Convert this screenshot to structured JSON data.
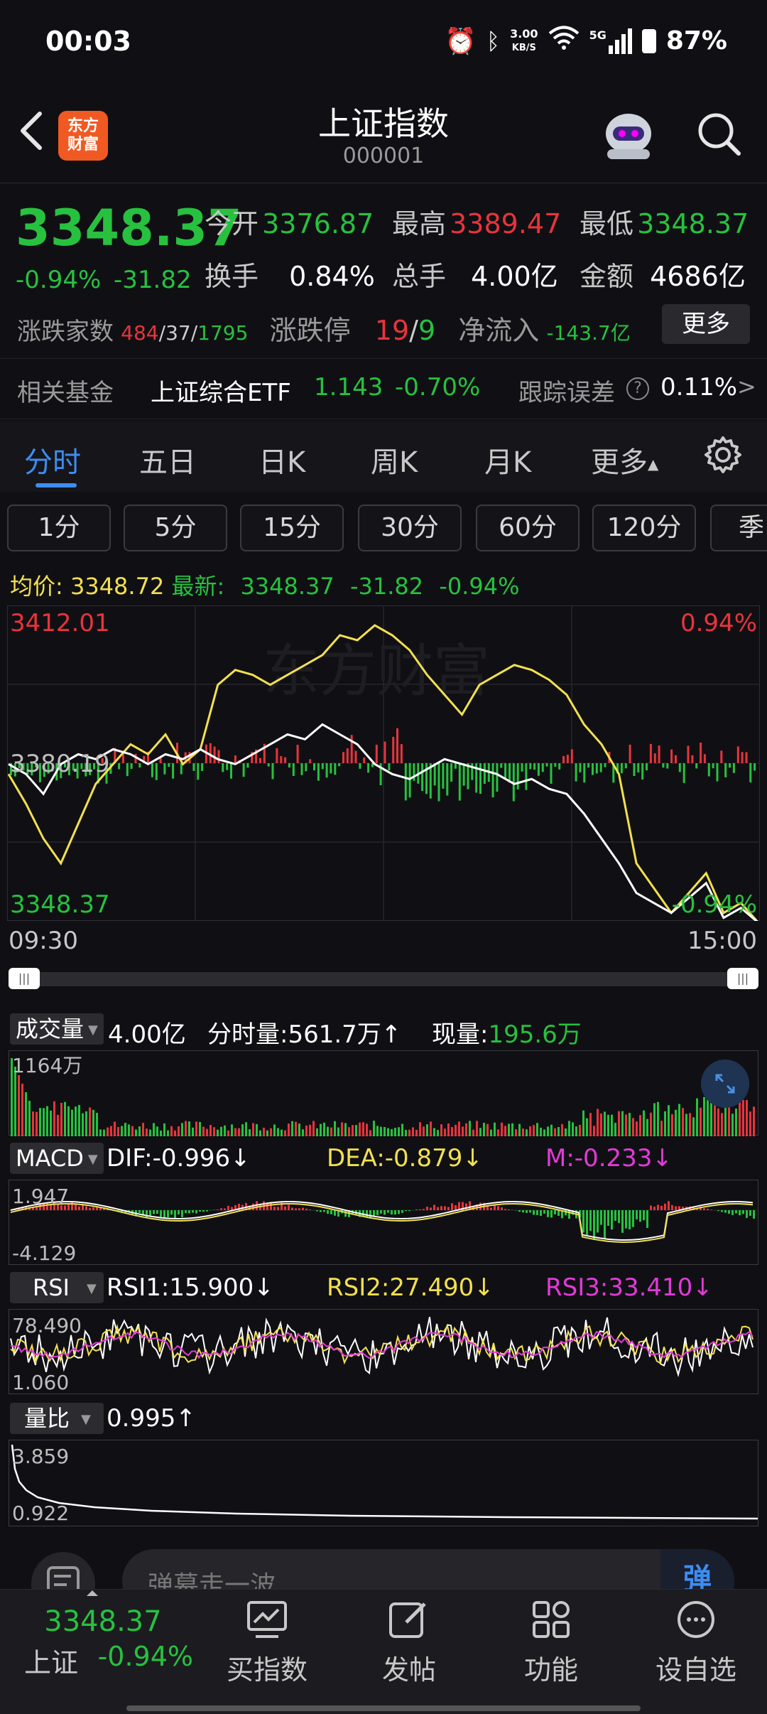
{
  "status": {
    "time": "00:03",
    "net_speed": "3.00",
    "net_unit": "KB/S",
    "signal": "5G",
    "battery": "87%"
  },
  "header": {
    "logo_line1": "东方",
    "logo_line2": "财富",
    "title": "上证指数",
    "code": "000001"
  },
  "quote": {
    "last": "3348.37",
    "chg_pct": "-0.94%",
    "chg_val": "-31.82",
    "open_label": "今开",
    "open": "3376.87",
    "high_label": "最高",
    "high": "3389.47",
    "low_label": "最低",
    "low": "3348.37",
    "turnover_label": "换手",
    "turnover": "0.84%",
    "volume_label": "总手",
    "volume": "4.00亿",
    "amount_label": "金额",
    "amount": "4686亿",
    "breadth_label": "涨跌家数",
    "breadth_up": "484",
    "breadth_flat": "37",
    "breadth_down": "1795",
    "limit_label": "涨跌停",
    "limit_up": "19",
    "limit_down": "9",
    "netflow_label": "净流入",
    "netflow": "-143.7亿",
    "more_label": "更多"
  },
  "fund": {
    "label": "相关基金",
    "name": "上证综合ETF",
    "price": "1.143",
    "chg": "-0.70%",
    "track_label": "跟踪误差",
    "track_value": "0.11%",
    "chevron": ">"
  },
  "tabs": [
    "分时",
    "五日",
    "日K",
    "周K",
    "月K",
    "更多"
  ],
  "periods": [
    "1分",
    "5分",
    "15分",
    "30分",
    "60分",
    "120分",
    "季"
  ],
  "avg_row": {
    "avg_label": "均价:",
    "avg": "3348.72",
    "latest_label": "最新:",
    "latest": "3348.37",
    "chg": "-31.82",
    "pct": "-0.94%"
  },
  "main_chart": {
    "top_left": "3412.01",
    "top_right": "0.94%",
    "mid_left": "3380.19",
    "bottom_left": "3348.37",
    "bottom_right": "-0.94%",
    "time_start": "09:30",
    "time_end": "15:00",
    "watermark": "东方财富"
  },
  "volume_panel": {
    "label": "成交量",
    "total": "4.00亿",
    "period_vol": "分时量:561.7万",
    "period_arrow": "↑",
    "now_label": "现量:",
    "now_value": "195.6万",
    "max_label": "1164万"
  },
  "macd_panel": {
    "label": "MACD",
    "dif": "DIF:-0.996",
    "dea": "DEA:-0.879",
    "m": "M:-0.233",
    "arrow": "↓",
    "top": "1.947",
    "bottom": "-4.129"
  },
  "rsi_panel": {
    "label": "RSI",
    "rsi1": "RSI1:15.900",
    "rsi2": "RSI2:27.490",
    "rsi3": "RSI3:33.410",
    "arrow": "↓",
    "top": "78.490",
    "bottom": "1.060"
  },
  "ratio_panel": {
    "label": "量比",
    "value": "0.995",
    "arrow": "↑",
    "top": "3.859",
    "bottom": "0.922"
  },
  "comment": {
    "placeholder": "弹幕走一波",
    "danmu": "弹"
  },
  "bottom_nav": {
    "index_price": "3348.37",
    "index_name": "上证",
    "index_pct": "-0.94%",
    "buy_index": "买指数",
    "post": "发帖",
    "functions": "功能",
    "add_watch": "设自选"
  },
  "chart_data": {
    "type": "line",
    "x_range": [
      "09:30",
      "15:00"
    ],
    "y_range": [
      3348.37,
      3412.01
    ],
    "prev_close": 3380.19,
    "series": [
      {
        "name": "均价",
        "color": "#f2e050",
        "values": [
          3378,
          3372,
          3365,
          3360,
          3368,
          3376,
          3380,
          3384,
          3382,
          3386,
          3380,
          3383,
          3396,
          3399,
          3398,
          3396,
          3398,
          3400,
          3402,
          3406,
          3405,
          3408,
          3406,
          3403,
          3398,
          3394,
          3390,
          3396,
          3398,
          3400,
          3399,
          3397,
          3394,
          3388,
          3384,
          3378,
          3360,
          3355,
          3350,
          3354,
          3358,
          3350,
          3352,
          3348
        ]
      },
      {
        "name": "最新",
        "color": "#ffffff",
        "values": [
          3380,
          3378,
          3374,
          3380,
          3382,
          3381,
          3383,
          3382,
          3380,
          3382,
          3381,
          3383,
          3381,
          3380,
          3382,
          3384,
          3386,
          3385,
          3388,
          3386,
          3384,
          3380,
          3378,
          3377,
          3379,
          3381,
          3380,
          3379,
          3378,
          3376,
          3377,
          3375,
          3374,
          3370,
          3365,
          3360,
          3354,
          3352,
          3350,
          3353,
          3356,
          3349,
          3351,
          3348
        ]
      }
    ]
  }
}
